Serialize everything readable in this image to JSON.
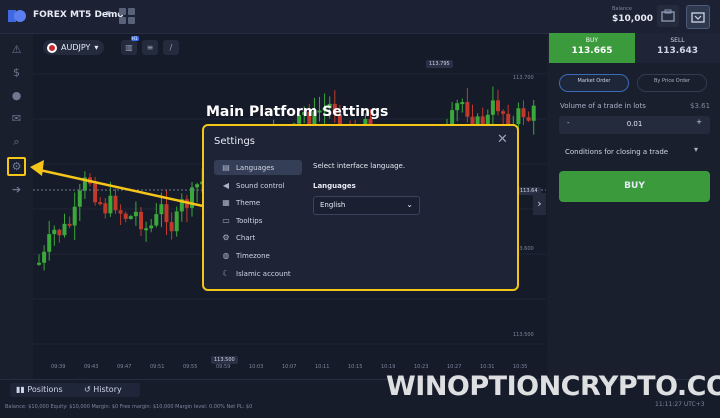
{
  "topbar": {
    "account_name": "FOREX MT5 Demo",
    "balance_label": "Balance",
    "balance_value": "$10,000"
  },
  "chart": {
    "asset": "AUDJPY",
    "h1_badge": "H1",
    "price_labels": [
      "113.795",
      "113.700",
      "113.64",
      "113.600",
      "113.500",
      "113.500"
    ],
    "time_labels": [
      "09:39",
      "09:43",
      "09:47",
      "09:51",
      "09:55",
      "09:59",
      "10:03",
      "10:07",
      "10:11",
      "10:15",
      "10:19",
      "10:23",
      "10:27",
      "10:31",
      "10:35"
    ]
  },
  "annotation": {
    "title": "Main Platform Settings"
  },
  "settings": {
    "title": "Settings",
    "menu": [
      {
        "label": "Languages",
        "icon": "translate-icon"
      },
      {
        "label": "Sound control",
        "icon": "sound-icon"
      },
      {
        "label": "Theme",
        "icon": "theme-grid-icon"
      },
      {
        "label": "Tooltips",
        "icon": "tooltip-icon"
      },
      {
        "label": "Chart",
        "icon": "gear-icon"
      },
      {
        "label": "Timezone",
        "icon": "globe-icon"
      },
      {
        "label": "Islamic account",
        "icon": "crescent-icon"
      }
    ],
    "description": "Select interface language.",
    "language_label": "Languages",
    "language_value": "English"
  },
  "trade": {
    "buy_label": "BUY",
    "buy_price": "113.665",
    "sell_label": "SELL",
    "sell_price": "113.643",
    "market_order": "Market Order",
    "by_price_order": "By Price Order",
    "volume_label": "Volume of a trade in lots",
    "volume_max": "$3.61",
    "quantity": "0.01",
    "minus": "-",
    "plus": "+",
    "conditions": "Conditions for closing a trade",
    "buy_button": "BUY"
  },
  "bottom": {
    "positions": "Positions",
    "history": "History",
    "status": "Balance: $10,000   Equity: $10,000   Margin: $0   Free margin: $10,000   Margin level: 0.00%   Net PL: $0",
    "clock": "11:11:27 UTC+3"
  },
  "watermark": "WINOPTIONCRYPTO.COM",
  "colors": {
    "accent_yellow": "#f5c518",
    "buy_green": "#3a9a3c",
    "candle_green": "#3aa83a",
    "candle_red": "#c0392b"
  }
}
